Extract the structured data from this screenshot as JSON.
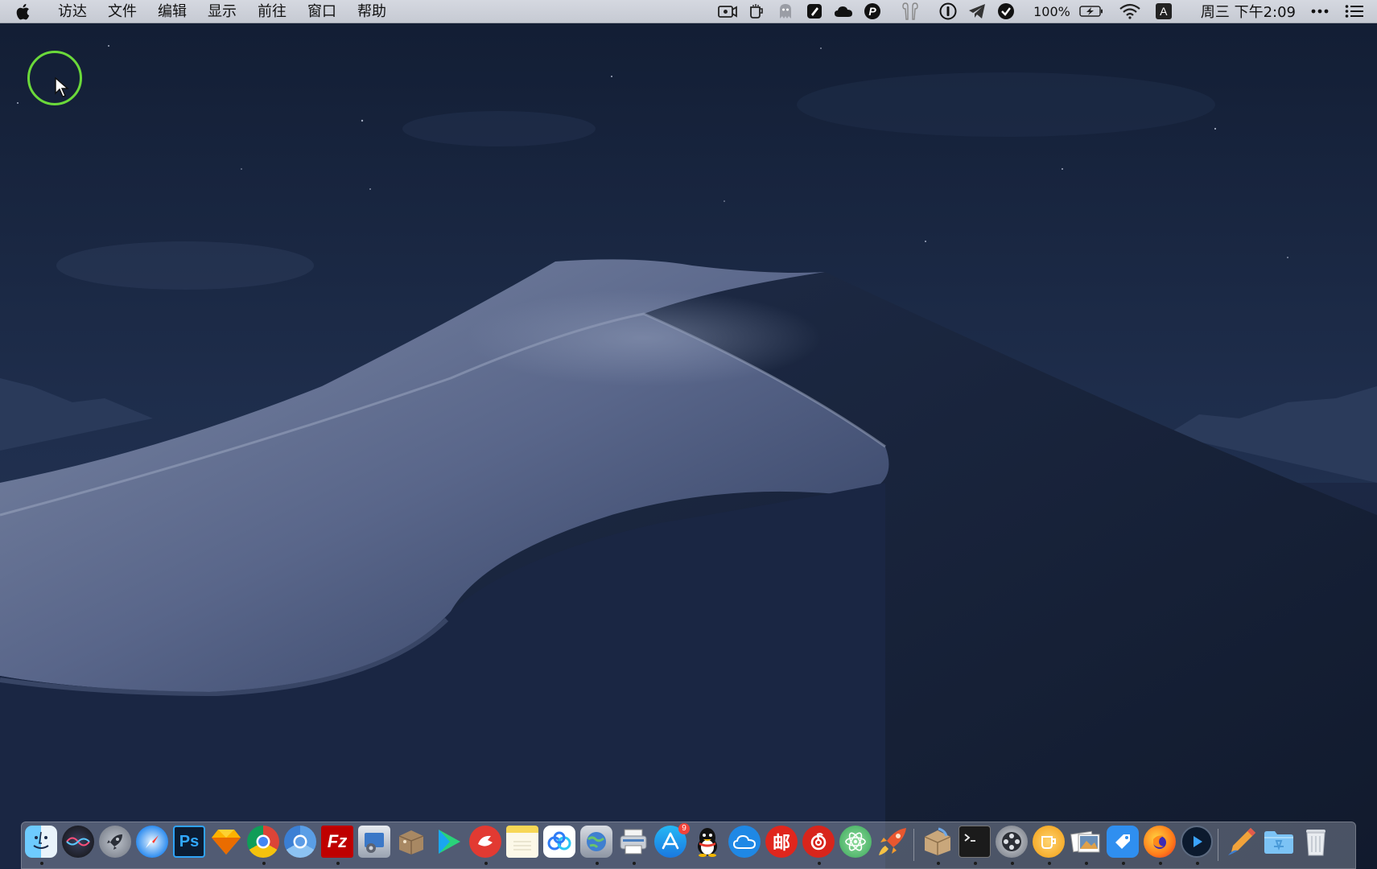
{
  "menubar": {
    "apple_icon": "apple-logo-icon",
    "menus": [
      "访达",
      "文件",
      "编辑",
      "显示",
      "前往",
      "窗口",
      "帮助"
    ],
    "status_icons": [
      "screen-recorder-icon",
      "cup-icon",
      "ghost-icon",
      "evernote-icon",
      "cloud-icon",
      "p-icon",
      "airpods-icon",
      "onepassword-icon",
      "telegram-icon",
      "check-circle-icon"
    ],
    "battery_text": "100%",
    "input_method": "A",
    "clock": "周三 下午2:09"
  },
  "colors": {
    "cursor_ring": "#6bd93a",
    "menubar_bg": "#cdd1d9",
    "sky": "#16233c",
    "dune_light": "#6a7691"
  },
  "dock": {
    "apps": [
      {
        "name": "finder",
        "icon": "finder-icon",
        "running": true
      },
      {
        "name": "siri",
        "icon": "siri-icon",
        "running": false
      },
      {
        "name": "launchpad",
        "icon": "rocket-icon",
        "running": false
      },
      {
        "name": "safari",
        "icon": "compass-icon",
        "running": false
      },
      {
        "name": "photoshop",
        "icon": "photoshop-icon",
        "label": "Ps",
        "running": false
      },
      {
        "name": "sketch",
        "icon": "diamond-icon",
        "running": false
      },
      {
        "name": "chrome",
        "icon": "chrome-icon",
        "running": true
      },
      {
        "name": "chromium",
        "icon": "chromium-icon",
        "running": false
      },
      {
        "name": "filezilla",
        "icon": "filezilla-icon",
        "label": "Fz",
        "running": true
      },
      {
        "name": "system-preferences",
        "icon": "preferences-icon",
        "running": false
      },
      {
        "name": "archive-utility",
        "icon": "box-icon",
        "running": false
      },
      {
        "name": "iqiyi",
        "icon": "play-icon",
        "running": false
      },
      {
        "name": "red-app",
        "icon": "red-bird-icon",
        "running": true
      },
      {
        "name": "notes",
        "icon": "notes-icon",
        "running": false
      },
      {
        "name": "baidu-netdisk",
        "icon": "cloud-link-icon",
        "running": false
      },
      {
        "name": "network-utility",
        "icon": "globe-icon",
        "running": true
      },
      {
        "name": "scanner",
        "icon": "printer-icon",
        "running": true
      },
      {
        "name": "app-store",
        "icon": "app-store-icon",
        "badge": "9",
        "running": false
      },
      {
        "name": "qq",
        "icon": "penguin-icon",
        "running": false
      },
      {
        "name": "icloud",
        "icon": "icloud-icon",
        "running": false
      },
      {
        "name": "mail-app",
        "icon": "mail-red-icon",
        "label": "邮",
        "running": false
      },
      {
        "name": "netease-music",
        "icon": "music-icon",
        "running": true
      },
      {
        "name": "atom",
        "icon": "atom-icon",
        "running": false
      },
      {
        "name": "rocket-typist",
        "icon": "feather-rocket-icon",
        "running": false
      },
      {
        "name": "installer",
        "icon": "package-icon",
        "running": true
      },
      {
        "name": "terminal",
        "icon": "terminal-icon",
        "running": true
      },
      {
        "name": "dvd-player",
        "icon": "film-icon",
        "running": true
      },
      {
        "name": "cup-app",
        "icon": "cup-orange-icon",
        "running": true
      },
      {
        "name": "preview",
        "icon": "photos-icon",
        "running": true
      },
      {
        "name": "paste-app",
        "icon": "tag-icon",
        "running": true
      },
      {
        "name": "firefox",
        "icon": "firefox-icon",
        "running": true
      },
      {
        "name": "quicktime",
        "icon": "quicktime-icon",
        "running": true
      },
      {
        "name": "pencil-app",
        "icon": "pencil-icon",
        "running": false
      },
      {
        "name": "applications-folder",
        "icon": "folder-icon",
        "running": false
      },
      {
        "name": "trash",
        "icon": "trash-icon",
        "running": false
      }
    ]
  }
}
